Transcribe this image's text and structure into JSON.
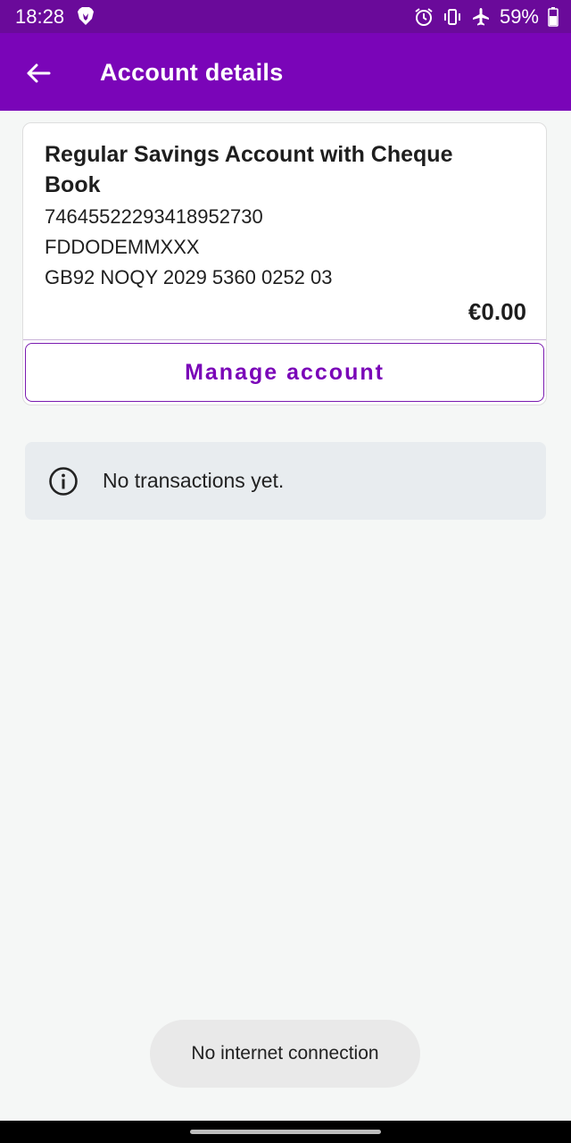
{
  "status_bar": {
    "time": "18:28",
    "battery": "59%",
    "icons": [
      "brave-icon",
      "alarm-icon",
      "vibrate-icon",
      "airplane-mode-icon",
      "battery-icon"
    ]
  },
  "app_bar": {
    "title": "Account details",
    "back_icon": "arrow-left-icon",
    "background_color": "#7a05b8"
  },
  "account": {
    "name": "Regular Savings Account with Cheque Book",
    "number": "74645522293418952730",
    "bic": "FDDODEMMXXX",
    "iban": "GB92 NOQY 2029 5360 0252 03",
    "balance": "€0.00",
    "manage_label": "Manage account"
  },
  "transactions": {
    "empty_message": "No transactions yet.",
    "icon": "info-icon"
  },
  "toast": {
    "message": "No internet connection"
  },
  "colors": {
    "accent": "#7a05b8",
    "status_bar": "#6a0a9a",
    "background": "#f5f7f6"
  }
}
